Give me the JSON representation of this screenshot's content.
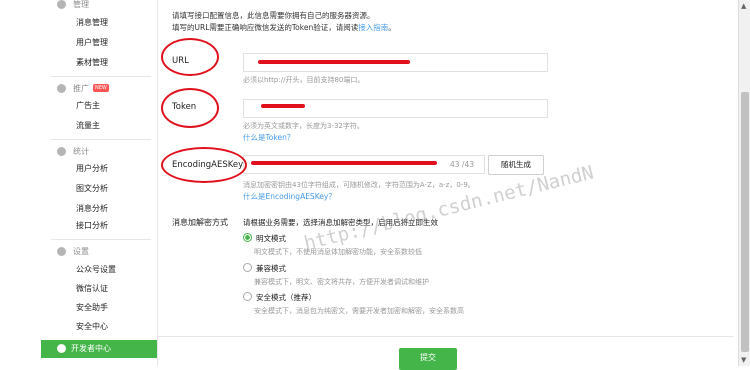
{
  "sidebar": {
    "sections": [
      {
        "label": "管理",
        "icon": "folder-icon",
        "items": [
          "消息管理",
          "用户管理",
          "素材管理"
        ]
      },
      {
        "label": "推广",
        "icon": "megaphone-icon",
        "badge": "NEW",
        "items": [
          "广告主",
          "流量主"
        ]
      },
      {
        "label": "统计",
        "icon": "pie-chart-icon",
        "items": [
          "用户分析",
          "图文分析",
          "消息分析",
          "接口分析"
        ]
      },
      {
        "label": "设置",
        "icon": "gear-icon",
        "items": [
          "公众号设置",
          "微信认证",
          "安全助手",
          "安全中心"
        ]
      }
    ],
    "active_item": "开发者中心",
    "active_icon": "developer-icon"
  },
  "intro": {
    "line1": "请填写接口配置信息，此信息需要你拥有自己的服务器资源。",
    "line2_prefix": "填写的URL需要正确响应微信发送的Token验证，请阅读",
    "line2_link": "接入指南",
    "line2_suffix": "。"
  },
  "url": {
    "label": "URL",
    "hint": "必须以http://开头，目前支持80端口。"
  },
  "token": {
    "label": "Token",
    "hint": "必须为英文或数字，长度为3-32字符。",
    "link": "什么是Token？"
  },
  "aes": {
    "label": "EncodingAESKey",
    "counter": "43 /43",
    "random_button": "随机生成",
    "hint": "消息加密密钥由43位字符组成，可随机修改，字符范围为A-Z，a-z，0-9。",
    "link": "什么是EncodingAESKey？"
  },
  "encryption": {
    "label": "消息加解密方式",
    "description": "请根据业务需要，选择消息加解密类型，启用后将立即生效",
    "options": [
      {
        "label": "明文模式",
        "desc": "明文模式下，不使用消息体加解密功能，安全系数较低",
        "selected": true
      },
      {
        "label": "兼容模式",
        "desc": "兼容模式下，明文、密文将共存，方便开发者调试和维护",
        "selected": false
      },
      {
        "label": "安全模式（推荐）",
        "desc": "安全模式下，消息包为纯密文，需要开发者加密和解密，安全系数高",
        "selected": false
      }
    ]
  },
  "submit_label": "提交",
  "watermark": "http://blog.csdn.net/NandN",
  "colors": {
    "accent": "#44b549",
    "link": "#459ae9",
    "annotation": "#e0101c"
  }
}
